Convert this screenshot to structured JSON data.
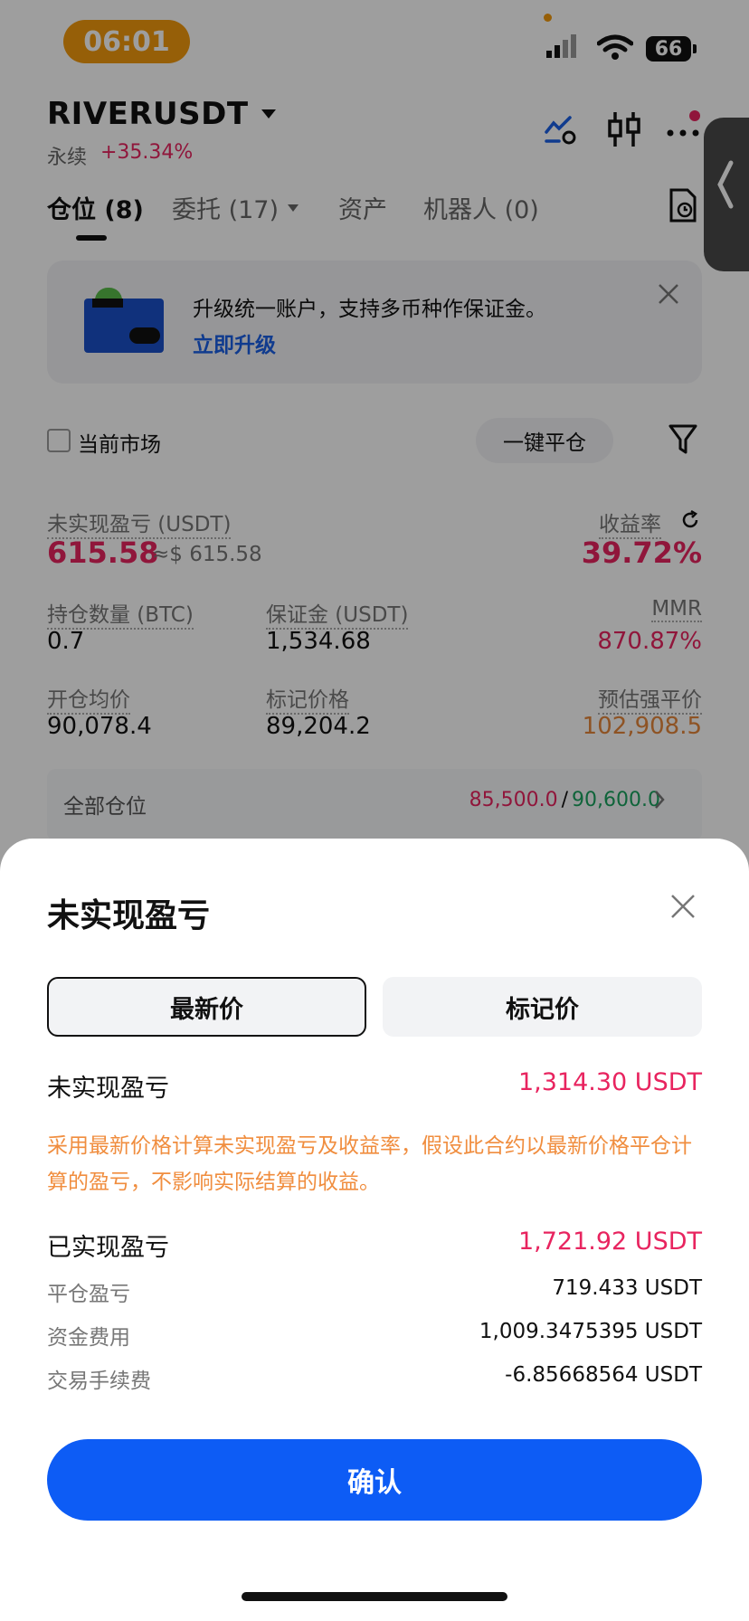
{
  "status_bar": {
    "time": "06:01",
    "battery": "66"
  },
  "header": {
    "symbol": "RIVERUSDT",
    "contract_type": "永续",
    "change": "+35.34%"
  },
  "tabs": [
    {
      "label": "仓位 (8)"
    },
    {
      "label": "委托 (17)"
    },
    {
      "label": "资产"
    },
    {
      "label": "机器人 (0)"
    }
  ],
  "banner": {
    "text": "升级统一账户，支持多币种作保证金。",
    "link": "立即升级"
  },
  "filter": {
    "current_market": "当前市场",
    "close_all": "一键平仓"
  },
  "position": {
    "unrealized_label": "未实现盈亏 (USDT)",
    "unrealized_value": "615.58",
    "unrealized_usd": "≈$ 615.58",
    "roe_label": "收益率",
    "roe_value": "39.72%",
    "size_label": "持仓数量 (BTC)",
    "size_value": "0.7",
    "margin_label": "保证金 (USDT)",
    "margin_value": "1,534.68",
    "mmr_label": "MMR",
    "mmr_value": "870.87%",
    "entry_label": "开仓均价",
    "entry_value": "90,078.4",
    "mark_label": "标记价格",
    "mark_value": "89,204.2",
    "liq_label": "预估强平价",
    "liq_value": "102,908.5",
    "all_positions_label": "全部仓位",
    "tp_value": "85,500.0",
    "sl_value": "90,600.0",
    "separator": "/"
  },
  "sheet": {
    "title": "未实现盈亏",
    "seg_latest": "最新价",
    "seg_mark": "标记价",
    "unrealized_label": "未实现盈亏",
    "unrealized_value": "1,314.30 USDT",
    "note": "采用最新价格计算未实现盈亏及收益率，假设此合约以最新价格平仓计算的盈亏，不影响实际结算的收益。",
    "realized_label": "已实现盈亏",
    "realized_value": "1,721.92 USDT",
    "close_pnl_label": "平仓盈亏",
    "close_pnl_value": "719.433 USDT",
    "funding_label": "资金费用",
    "funding_value": "1,009.3475395 USDT",
    "fee_label": "交易手续费",
    "fee_value": "-6.85668564 USDT",
    "confirm": "确认"
  },
  "colors": {
    "accent_blue": "#0d5cf5",
    "profit_red": "#e8245f",
    "warning_orange": "#f08d3e"
  },
  "icons": [
    "wifi-icon",
    "signal-icon",
    "battery-icon",
    "chart-settings-icon",
    "candlestick-icon",
    "more-icon",
    "history-icon",
    "close-icon",
    "filter-icon",
    "refresh-icon",
    "chevron-right-icon",
    "chevron-left-icon"
  ]
}
